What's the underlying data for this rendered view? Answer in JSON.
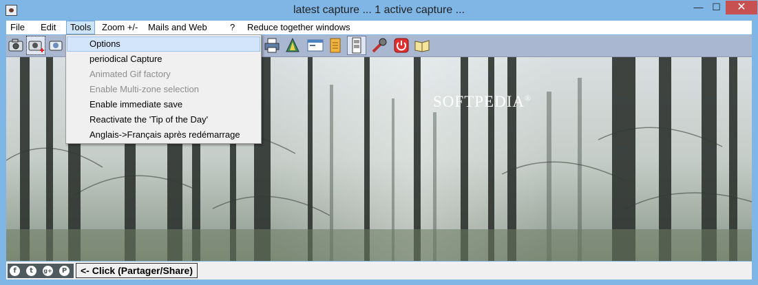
{
  "window": {
    "title": "latest capture ... 1 active capture ..."
  },
  "window_controls": {
    "minimize": "—",
    "maximize": "☐",
    "close": "✕"
  },
  "menubar": {
    "items": [
      {
        "label": "File"
      },
      {
        "label": "Edit"
      },
      {
        "label": "Tools"
      },
      {
        "label": "Zoom +/-"
      },
      {
        "label": "Mails and Web"
      },
      {
        "label": "?"
      },
      {
        "label": "Reduce together windows"
      }
    ]
  },
  "tools_menu": {
    "items": [
      {
        "label": "Options",
        "enabled": true
      },
      {
        "label": "periodical Capture",
        "enabled": true
      },
      {
        "label": "Animated Gif factory",
        "enabled": false
      },
      {
        "label": "Enable Multi-zone selection",
        "enabled": false
      },
      {
        "label": "Enable immediate save",
        "enabled": true
      },
      {
        "label": "Reactivate the 'Tip of the Day'",
        "enabled": true
      },
      {
        "label": "Anglais->Français après redémarrage",
        "enabled": true
      }
    ]
  },
  "toolbar": {
    "icons": [
      "camera-icon",
      "camera-add-icon",
      "camera-zone-icon",
      "printer-icon",
      "palette-icon",
      "window-icon",
      "scroll-icon",
      "film-icon",
      "tools-icon",
      "power-icon",
      "help-book-icon"
    ]
  },
  "capture": {
    "watermark": "SOFTPEDIA",
    "watermark_mark": "®"
  },
  "statusbar": {
    "social": [
      "f",
      "t",
      "g+",
      "P"
    ],
    "share_text": "<- Click (Partager/Share)"
  },
  "colors": {
    "titlebar": "#7fb6e6",
    "close": "#c75050",
    "toolbar": "#aab7d0"
  }
}
